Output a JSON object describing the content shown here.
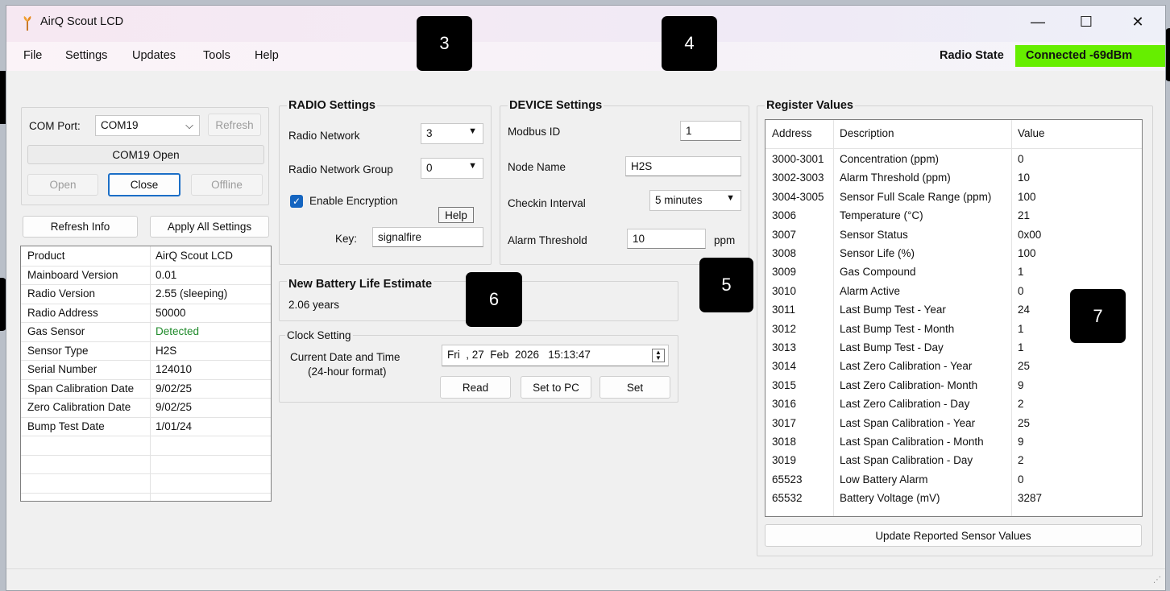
{
  "window": {
    "title": "AirQ Scout LCD",
    "minimize": "—",
    "maximize": "☐",
    "close": "✕"
  },
  "menu": [
    "File",
    "Settings",
    "Updates",
    "Tools",
    "Help"
  ],
  "radio_state": {
    "label": "Radio State",
    "value": "Connected -69dBm",
    "color": "#66ee00"
  },
  "com": {
    "port_label": "COM Port:",
    "port_value": "COM19",
    "refresh": "Refresh",
    "status": "COM19 Open",
    "open": "Open",
    "close": "Close",
    "offline": "Offline"
  },
  "actions": {
    "refresh_info": "Refresh Info",
    "apply_all": "Apply All Settings"
  },
  "info": [
    [
      "Product",
      "AirQ Scout LCD"
    ],
    [
      "Mainboard Version",
      "0.01"
    ],
    [
      "Radio Version",
      "2.55 (sleeping)"
    ],
    [
      "Radio Address",
      "50000"
    ],
    [
      "Gas Sensor",
      "Detected"
    ],
    [
      "Sensor Type",
      "H2S"
    ],
    [
      "Serial Number",
      "124010"
    ],
    [
      "Span Calibration Date",
      "9/02/25"
    ],
    [
      "Zero Calibration Date",
      "9/02/25"
    ],
    [
      "Bump Test Date",
      "1/01/24"
    ]
  ],
  "detected_color": "#1f8a2a",
  "radio": {
    "title": "RADIO Settings",
    "network_label": "Radio Network",
    "network_value": "3",
    "group_label": "Radio Network Group",
    "group_value": "0",
    "encryption_label": "Enable Encryption",
    "help": "Help",
    "key_label": "Key:",
    "key_value": "signalfire"
  },
  "device": {
    "title": "DEVICE Settings",
    "modbus_label": "Modbus ID",
    "modbus_value": "1",
    "node_label": "Node Name",
    "node_value": "H2S",
    "checkin_label": "Checkin Interval",
    "checkin_value": "5 minutes",
    "alarm_label": "Alarm Threshold",
    "alarm_value": "10",
    "alarm_unit": "ppm"
  },
  "battery": {
    "title": "New Battery Life Estimate",
    "value": "2.06 years"
  },
  "clock": {
    "title": "Clock Setting",
    "label_line1": "Current Date and Time",
    "label_line2": "(24-hour format)",
    "value": "Fri  , 27  Feb  2026   15:13:47",
    "read": "Read",
    "set_to_pc": "Set to PC",
    "set": "Set"
  },
  "register": {
    "title": "Register Values",
    "headers": [
      "Address",
      "Description",
      "Value"
    ],
    "rows": [
      [
        "3000-3001",
        "Concentration (ppm)",
        "0"
      ],
      [
        "3002-3003",
        "Alarm Threshold (ppm)",
        "10"
      ],
      [
        "3004-3005",
        "Sensor Full Scale Range (ppm)",
        "100"
      ],
      [
        "3006",
        "Temperature (°C)",
        "21"
      ],
      [
        "3007",
        "Sensor Status",
        "0x00"
      ],
      [
        "3008",
        "Sensor Life (%)",
        "100"
      ],
      [
        "3009",
        "Gas Compound",
        "1"
      ],
      [
        "3010",
        "Alarm Active",
        "0"
      ],
      [
        "3011",
        "Last Bump Test - Year",
        "24"
      ],
      [
        "3012",
        "Last Bump Test - Month",
        "1"
      ],
      [
        "3013",
        "Last Bump Test - Day",
        "1"
      ],
      [
        "3014",
        "Last Zero Calibration - Year",
        "25"
      ],
      [
        "3015",
        "Last Zero Calibration- Month",
        "9"
      ],
      [
        "3016",
        "Last Zero Calibration - Day",
        "2"
      ],
      [
        "3017",
        "Last Span Calibration - Year",
        "25"
      ],
      [
        "3018",
        "Last Span Calibration - Month",
        "9"
      ],
      [
        "3019",
        "Last Span Calibration - Day",
        "2"
      ],
      [
        "65523",
        "Low Battery Alarm",
        "0"
      ],
      [
        "65532",
        "Battery Voltage (mV)",
        "3287"
      ]
    ],
    "update_button": "Update Reported Sensor Values"
  },
  "callouts": [
    "3",
    "4",
    "5",
    "6",
    "7"
  ]
}
